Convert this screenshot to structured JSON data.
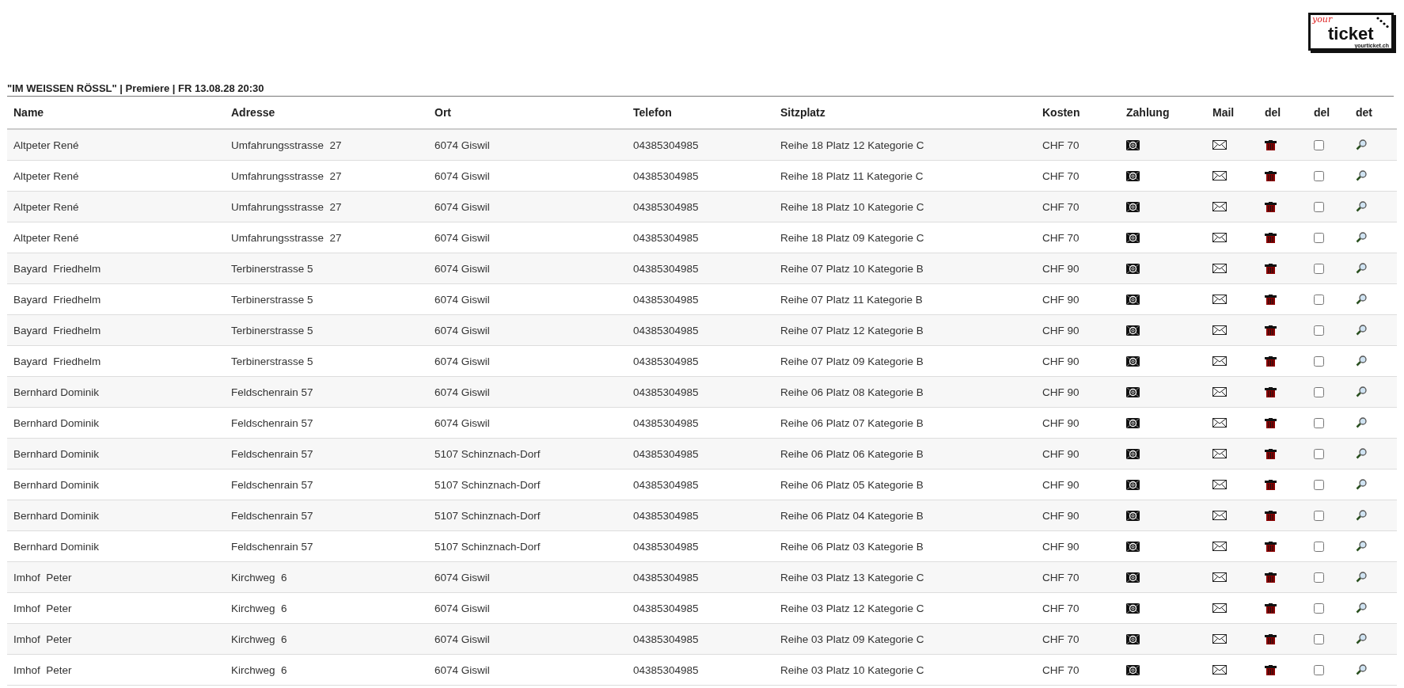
{
  "logo": {
    "script": "your",
    "word": "ticket",
    "domain": "yourticket.ch"
  },
  "event_title": "\"IM WEISSEN RÖSSL\" | Premiere | FR 13.08.28 20:30",
  "table": {
    "columns": [
      "Name",
      "Adresse",
      "Ort",
      "Telefon",
      "Sitzplatz",
      "Kosten",
      "Zahlung",
      "Mail",
      "del",
      "del",
      "det"
    ],
    "rows": [
      {
        "name": "Altpeter René",
        "address": "Umfahrungsstrasse  27",
        "city": "6074 Giswil",
        "phone": "04385304985",
        "seat": "Reihe 18 Platz 12 Kategorie C",
        "cost": "CHF 70",
        "checked": false
      },
      {
        "name": "Altpeter René",
        "address": "Umfahrungsstrasse  27",
        "city": "6074 Giswil",
        "phone": "04385304985",
        "seat": "Reihe 18 Platz 11 Kategorie C",
        "cost": "CHF 70",
        "checked": false
      },
      {
        "name": "Altpeter René",
        "address": "Umfahrungsstrasse  27",
        "city": "6074 Giswil",
        "phone": "04385304985",
        "seat": "Reihe 18 Platz 10 Kategorie C",
        "cost": "CHF 70",
        "checked": false
      },
      {
        "name": "Altpeter René",
        "address": "Umfahrungsstrasse  27",
        "city": "6074 Giswil",
        "phone": "04385304985",
        "seat": "Reihe 18 Platz 09 Kategorie C",
        "cost": "CHF 70",
        "checked": false
      },
      {
        "name": "Bayard  Friedhelm",
        "address": "Terbinerstrasse 5",
        "city": "6074 Giswil",
        "phone": "04385304985",
        "seat": "Reihe 07 Platz 10 Kategorie B",
        "cost": "CHF 90",
        "checked": false
      },
      {
        "name": "Bayard  Friedhelm",
        "address": "Terbinerstrasse 5",
        "city": "6074 Giswil",
        "phone": "04385304985",
        "seat": "Reihe 07 Platz 11 Kategorie B",
        "cost": "CHF 90",
        "checked": false
      },
      {
        "name": "Bayard  Friedhelm",
        "address": "Terbinerstrasse 5",
        "city": "6074 Giswil",
        "phone": "04385304985",
        "seat": "Reihe 07 Platz 12 Kategorie B",
        "cost": "CHF 90",
        "checked": false
      },
      {
        "name": "Bayard  Friedhelm",
        "address": "Terbinerstrasse 5",
        "city": "6074 Giswil",
        "phone": "04385304985",
        "seat": "Reihe 07 Platz 09 Kategorie B",
        "cost": "CHF 90",
        "checked": false
      },
      {
        "name": "Bernhard Dominik",
        "address": "Feldschenrain 57",
        "city": "6074 Giswil",
        "phone": "04385304985",
        "seat": "Reihe 06 Platz 08 Kategorie B",
        "cost": "CHF 90",
        "checked": false
      },
      {
        "name": "Bernhard Dominik",
        "address": "Feldschenrain 57",
        "city": "6074 Giswil",
        "phone": "04385304985",
        "seat": "Reihe 06 Platz 07 Kategorie B",
        "cost": "CHF 90",
        "checked": false
      },
      {
        "name": "Bernhard Dominik",
        "address": "Feldschenrain 57",
        "city": "5107 Schinznach-Dorf",
        "phone": "04385304985",
        "seat": "Reihe 06 Platz 06 Kategorie B",
        "cost": "CHF 90",
        "checked": false
      },
      {
        "name": "Bernhard Dominik",
        "address": "Feldschenrain 57",
        "city": "5107 Schinznach-Dorf",
        "phone": "04385304985",
        "seat": "Reihe 06 Platz 05 Kategorie B",
        "cost": "CHF 90",
        "checked": false
      },
      {
        "name": "Bernhard Dominik",
        "address": "Feldschenrain 57",
        "city": "5107 Schinznach-Dorf",
        "phone": "04385304985",
        "seat": "Reihe 06 Platz 04 Kategorie B",
        "cost": "CHF 90",
        "checked": false
      },
      {
        "name": "Bernhard Dominik",
        "address": "Feldschenrain 57",
        "city": "5107 Schinznach-Dorf",
        "phone": "04385304985",
        "seat": "Reihe 06 Platz 03 Kategorie B",
        "cost": "CHF 90",
        "checked": false
      },
      {
        "name": "Imhof  Peter",
        "address": "Kirchweg  6",
        "city": "6074 Giswil",
        "phone": "04385304985",
        "seat": "Reihe 03 Platz 13 Kategorie C",
        "cost": "CHF 70",
        "checked": false
      },
      {
        "name": "Imhof  Peter",
        "address": "Kirchweg  6",
        "city": "6074 Giswil",
        "phone": "04385304985",
        "seat": "Reihe 03 Platz 12 Kategorie C",
        "cost": "CHF 70",
        "checked": false
      },
      {
        "name": "Imhof  Peter",
        "address": "Kirchweg  6",
        "city": "6074 Giswil",
        "phone": "04385304985",
        "seat": "Reihe 03 Platz 09 Kategorie C",
        "cost": "CHF 70",
        "checked": false
      },
      {
        "name": "Imhof  Peter",
        "address": "Kirchweg  6",
        "city": "6074 Giswil",
        "phone": "04385304985",
        "seat": "Reihe 03 Platz 10 Kategorie C",
        "cost": "CHF 70",
        "checked": false
      }
    ]
  }
}
